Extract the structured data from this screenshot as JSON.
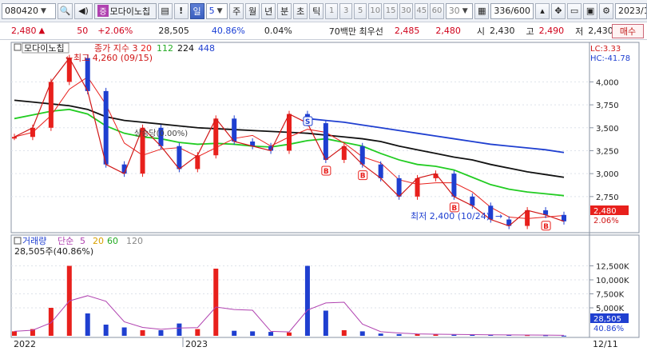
{
  "toolbar": {
    "code": "080420",
    "stock_badge": "증",
    "stock_name": "모다이노칩",
    "alert": "!",
    "period_active": "일",
    "period_value": "5",
    "periods": [
      "주",
      "월",
      "년",
      "분",
      "초",
      "틱"
    ],
    "intervals": [
      "1",
      "3",
      "5",
      "10",
      "15",
      "30",
      "45",
      "60"
    ],
    "interval_select": "30",
    "count": "336/600",
    "date": "2023/1"
  },
  "quote": {
    "price": "2,480",
    "arrow": "▲",
    "change": "50",
    "change_pct": "+2.06%",
    "volume": "28,505",
    "turnover_pct": "40.86%",
    "ratio": "0.04%",
    "bid_label": "70백만 최우선",
    "bid1": "2,485",
    "bid2": "2,480",
    "open_label": "시",
    "open": "2,430",
    "high_label": "고",
    "high": "2,490",
    "low_label": "저",
    "low": "2,430",
    "buy_button": "매수"
  },
  "colors": {
    "up": "#e8201c",
    "down": "#1f3fd0",
    "ma3": "#d01818",
    "ma20": "#e8201c",
    "ma112": "#22cc22",
    "ma224": "#111111",
    "ma448": "#1f3fd0"
  },
  "price_panel": {
    "legend_name": "모다이노칩",
    "legend_label": "종가 지수 3",
    "ma_periods": [
      "20",
      "112",
      "224",
      "448"
    ],
    "lc": "LC:3.33",
    "hc": "HC:-41.78",
    "high_annotation": "최고 4,260 (09/15)",
    "low_annotation": "최저 2,400 (10/24)",
    "mid_annotation": "상승당(0.00%)",
    "price_tag": "2,480",
    "pct_tag": "2.06%",
    "y_ticks": [
      "4,000",
      "3,750",
      "3,500",
      "3,250",
      "3,000",
      "2,750"
    ]
  },
  "volume_panel": {
    "legend_label": "거래량",
    "legend_ma": "단순",
    "ma_periods": [
      "5",
      "20",
      "60",
      "120"
    ],
    "sub_label": "28,505주(40.86%)",
    "volume_tag": "28,505",
    "pct_tag": "40.86%",
    "y_ticks": [
      "12,500K",
      "10,000K",
      "7,500K",
      "5,000K"
    ]
  },
  "x_axis": {
    "labels": [
      "2022",
      "2023"
    ],
    "last_label": "12/11"
  },
  "chart_data": [
    {
      "type": "line",
      "title": "",
      "series": [
        {
          "name": "모다이노칩",
          "values": [
            3400,
            3500,
            4000,
            4260,
            3900,
            3100,
            3000,
            3500,
            3300,
            3050,
            3200,
            3600,
            3350,
            3300,
            3250,
            3650,
            3550,
            3150,
            3300,
            3100,
            2950,
            2750,
            2950,
            3000,
            2750,
            2650,
            2500,
            2430,
            2600,
            2550,
            2480
          ]
        },
        {
          "name": "224",
          "values": [
            3800,
            3780,
            3760,
            3740,
            3700,
            3620,
            3580,
            3560,
            3540,
            3520,
            3500,
            3490,
            3480,
            3470,
            3460,
            3450,
            3440,
            3420,
            3400,
            3380,
            3350,
            3300,
            3260,
            3220,
            3180,
            3150,
            3100,
            3060,
            3020,
            2990,
            2960
          ]
        },
        {
          "name": "112",
          "values": [
            3600,
            3640,
            3680,
            3700,
            3650,
            3520,
            3440,
            3400,
            3380,
            3340,
            3320,
            3330,
            3320,
            3300,
            3290,
            3320,
            3360,
            3380,
            3340,
            3300,
            3220,
            3150,
            3100,
            3080,
            3040,
            2960,
            2880,
            2830,
            2800,
            2780,
            2760
          ]
        },
        {
          "name": "448",
          "values": [
            null,
            null,
            null,
            null,
            null,
            null,
            null,
            null,
            null,
            null,
            null,
            null,
            null,
            null,
            null,
            null,
            3600,
            3580,
            3560,
            3530,
            3500,
            3470,
            3440,
            3410,
            3380,
            3350,
            3320,
            3300,
            3280,
            3260,
            3230
          ]
        }
      ],
      "ylim": [
        2400,
        4300
      ]
    },
    {
      "type": "bar",
      "title": "",
      "series": [
        {
          "name": "거래량",
          "values": [
            800,
            1200,
            5000,
            12500,
            4000,
            2000,
            1500,
            1000,
            1000,
            2200,
            1200,
            12000,
            900,
            800,
            700,
            600,
            12500,
            4500,
            1000,
            800,
            400,
            300,
            300,
            250,
            200,
            200,
            150,
            150,
            120,
            100,
            30
          ]
        }
      ],
      "ylim": [
        0,
        14000
      ]
    }
  ]
}
